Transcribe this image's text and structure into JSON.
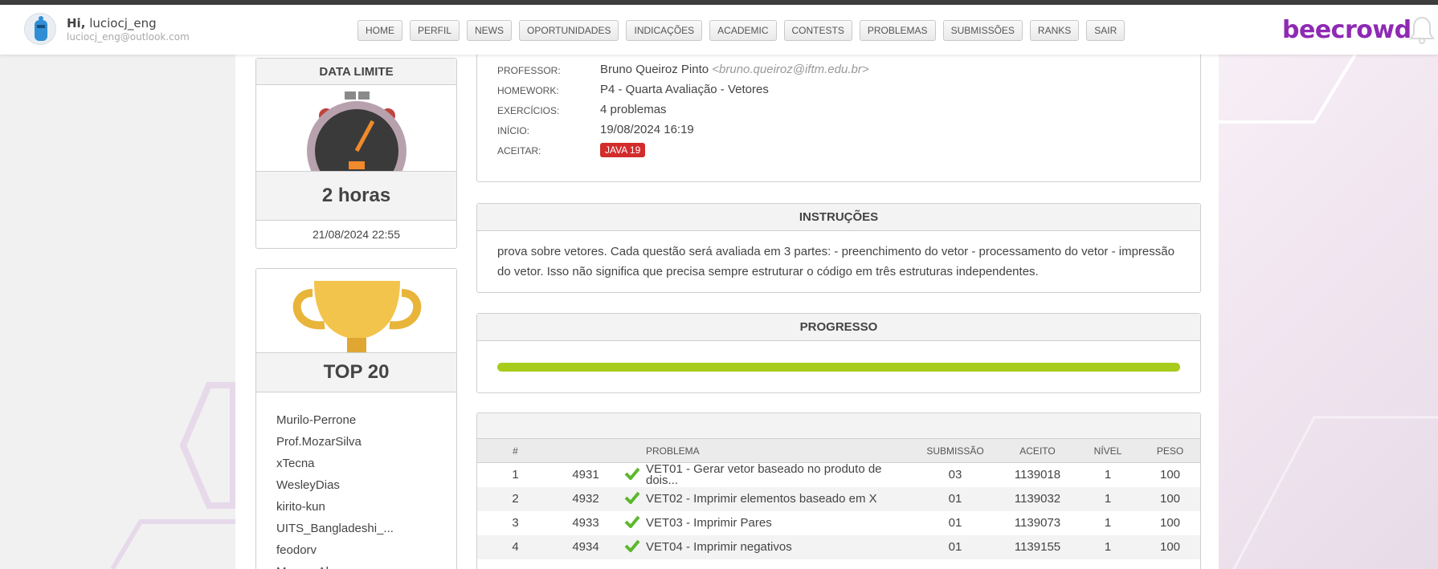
{
  "header": {
    "greeting": "Hi,",
    "username": "luciocj_eng",
    "email": "luciocj_eng@outlook.com",
    "nav": [
      "HOME",
      "PERFIL",
      "NEWS",
      "OPORTUNIDADES",
      "INDICAÇÕES",
      "ACADEMIC",
      "CONTESTS",
      "PROBLEMAS",
      "SUBMISSÕES",
      "RANKS",
      "SAIR"
    ],
    "logo": "beecrowd"
  },
  "deadline": {
    "title": "DATA LIMITE",
    "remaining": "2 horas",
    "date": "21/08/2024 22:55"
  },
  "top20": {
    "title": "TOP 20",
    "names": [
      "Murilo-Perrone",
      "Prof.MozarSilva",
      "xTecna",
      "WesleyDias",
      "kirito-kun",
      "UITS_Bangladeshi_...",
      "feodorv",
      "MoysesAlves"
    ]
  },
  "info": {
    "rows": [
      {
        "label": "PROFESSOR:",
        "value": "Bruno Queiroz Pinto",
        "extra": "<bruno.queiroz@iftm.edu.br>"
      },
      {
        "label": "HOMEWORK:",
        "value": "P4 - Quarta Avaliação - Vetores"
      },
      {
        "label": "EXERCÍCIOS:",
        "value": "4 problemas"
      },
      {
        "label": "INÍCIO:",
        "value": "19/08/2024 16:19"
      },
      {
        "label": "ACEITAR:",
        "value": "JAVA 19"
      }
    ]
  },
  "instructions": {
    "title": "INSTRUÇÕES",
    "text": "prova sobre vetores. Cada questão será avaliada em 3 partes: - preenchimento do vetor - processamento do vetor - impressão do vetor. Isso não significa que precisa sempre estruturar o código em três estruturas independentes."
  },
  "progress": {
    "title": "PROGRESSO",
    "fraction": 1.0,
    "color": "#a7cc1b"
  },
  "problems": {
    "headers": [
      "#",
      "",
      "",
      "PROBLEMA",
      "SUBMISSÃO",
      "ACEITO",
      "NÍVEL",
      "PESO"
    ],
    "rows": [
      {
        "n": "1",
        "id": "4931",
        "name": "VET01 - Gerar vetor baseado no produto de dois...",
        "sub": "03",
        "acc": "1139018",
        "lvl": "1",
        "peso": "100"
      },
      {
        "n": "2",
        "id": "4932",
        "name": "VET02 - Imprimir elementos baseado em X",
        "sub": "01",
        "acc": "1139032",
        "lvl": "1",
        "peso": "100"
      },
      {
        "n": "3",
        "id": "4933",
        "name": "VET03 - Imprimir Pares",
        "sub": "01",
        "acc": "1139073",
        "lvl": "1",
        "peso": "100"
      },
      {
        "n": "4",
        "id": "4934",
        "name": "VET04 - Imprimir negativos",
        "sub": "01",
        "acc": "1139155",
        "lvl": "1",
        "peso": "100"
      }
    ]
  },
  "colors": {
    "accent": "#8e2ab3",
    "check": "#5cb82d",
    "badge": "#d22c2c"
  }
}
